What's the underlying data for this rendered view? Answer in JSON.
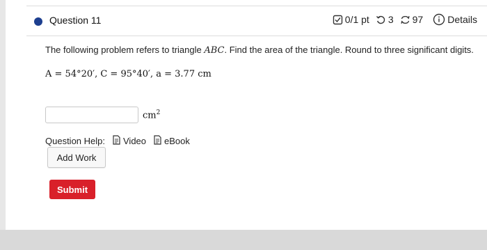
{
  "question": {
    "title": "Question 11",
    "score": "0/1 pt",
    "retries": "3",
    "attempts": "97",
    "details_label": "Details",
    "accent_color": "#1d3f8f"
  },
  "prompt": {
    "text_before": "The following problem refers to triangle ",
    "triangle": "ABC",
    "text_after": ". Find the area of the triangle. Round to three significant digits.",
    "equation": "A = 54°20′, C = 95°40′, a = 3.77 cm"
  },
  "answer": {
    "value": "",
    "unit": "cm",
    "unit_exp": "2"
  },
  "help": {
    "label": "Question Help:",
    "video": "Video",
    "ebook": "eBook"
  },
  "buttons": {
    "add_work": "Add Work",
    "submit": "Submit",
    "submit_color": "#d9202a"
  }
}
